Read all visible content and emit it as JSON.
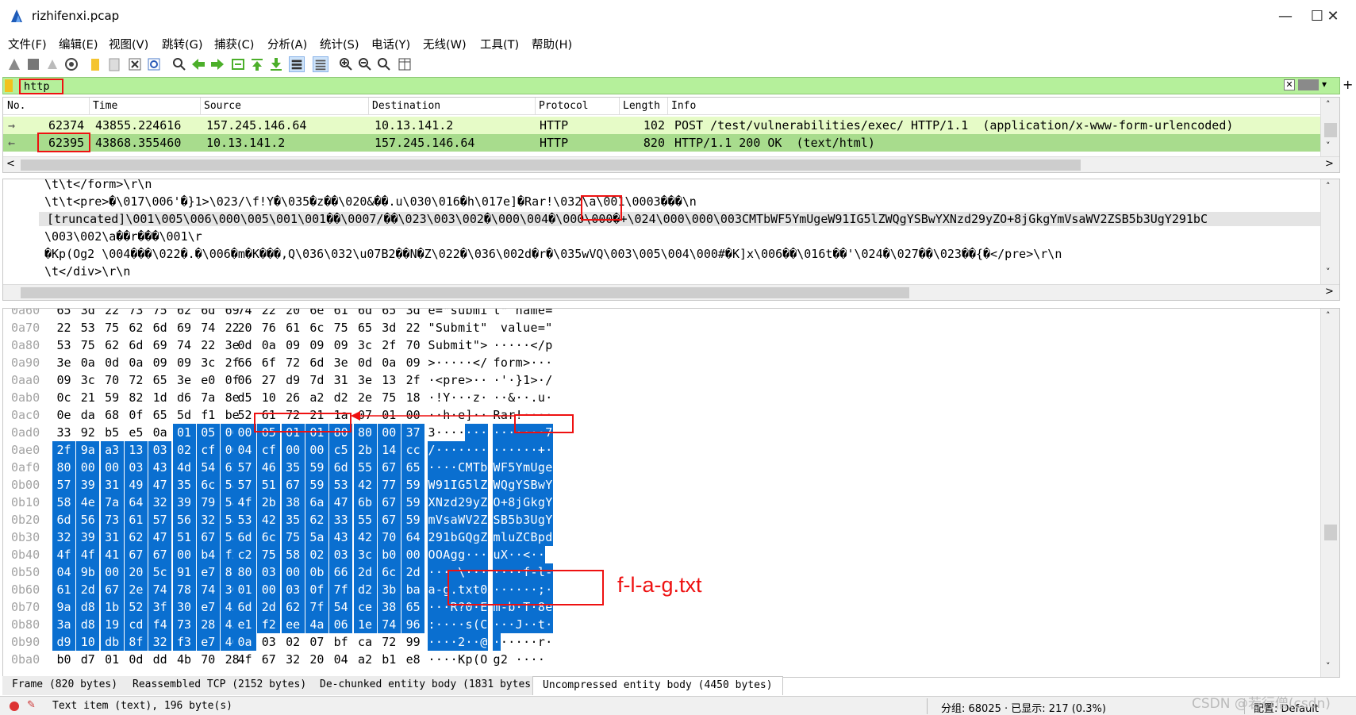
{
  "window": {
    "title": "rizhifenxi.pcap"
  },
  "menu": [
    "文件(F)",
    "编辑(E)",
    "视图(V)",
    "跳转(G)",
    "捕获(C)",
    "分析(A)",
    "统计(S)",
    "电话(Y)",
    "无线(W)",
    "工具(T)",
    "帮助(H)"
  ],
  "filter": {
    "value": "http"
  },
  "packet_list": {
    "columns": [
      "No.",
      "Time",
      "Source",
      "Destination",
      "Protocol",
      "Length",
      "Info"
    ],
    "rows": [
      {
        "no": "62374",
        "time": "43855.224616",
        "source": "157.245.146.64",
        "destination": "10.13.141.2",
        "protocol": "HTTP",
        "length": "102",
        "info": "POST /test/vulnerabilities/exec/ HTTP/1.1  (application/x-www-form-urlencoded)"
      },
      {
        "no": "62395",
        "time": "43868.355460",
        "source": "10.13.141.2",
        "destination": "157.245.146.64",
        "protocol": "HTTP",
        "length": "820",
        "info": "HTTP/1.1 200 OK  (text/html)"
      }
    ]
  },
  "text_pane": {
    "lines": [
      "\\t\\t</form>\\r\\n",
      "\\t\\t<pre>�\\017\\006'�}1>\\023/\\f!Y�\\035�z��\\020&��.u\\030\\016�h\\017e]�Rar!\\032\\a\\001\\0003���\\n",
      "[truncated]\\001\\005\\006\\000\\005\\001\\001��\\0007/��\\023\\003\\002�\\000\\004�\\000\\000�+\\024\\000\\000\\003CMTbWF5YmUgeW91IG5lZWQgYSBwYXNzd29yZO+8jGkgYmVsaWV2ZSB5b3UgY291bC",
      "\\003\\002\\a��r���\\001\\r",
      "�Kp(Og2 \\004���\\022�.�\\006�m�K���,Q\\036\\032\\u07B2��N�Z\\022�\\036\\002d�r�\\035wVQ\\003\\005\\004\\000#�K]x\\006��\\016t��'\\024�\\027��\\023��{�</pre>\\r\\n",
      "\\t</div>\\r\\n"
    ]
  },
  "hex_dump": {
    "rows": [
      {
        "offset": "0a60",
        "bytes": [
          "65",
          "3d",
          "22",
          "73",
          "75",
          "62",
          "6d",
          "69",
          "74",
          "22",
          "20",
          "6e",
          "61",
          "6d",
          "65",
          "3d"
        ],
        "ascii": "e=\"submit\" name="
      },
      {
        "offset": "0a70",
        "bytes": [
          "22",
          "53",
          "75",
          "62",
          "6d",
          "69",
          "74",
          "22",
          "20",
          "76",
          "61",
          "6c",
          "75",
          "65",
          "3d",
          "22"
        ],
        "ascii": "\"Submit\" value=\""
      },
      {
        "offset": "0a80",
        "bytes": [
          "53",
          "75",
          "62",
          "6d",
          "69",
          "74",
          "22",
          "3e",
          "0d",
          "0a",
          "09",
          "09",
          "09",
          "3c",
          "2f",
          "70"
        ],
        "ascii": "Submit\">·····</p"
      },
      {
        "offset": "0a90",
        "bytes": [
          "3e",
          "0a",
          "0d",
          "0a",
          "09",
          "09",
          "3c",
          "2f",
          "66",
          "6f",
          "72",
          "6d",
          "3e",
          "0d",
          "0a",
          "09"
        ],
        "ascii": ">·····</form>···"
      },
      {
        "offset": "0aa0",
        "bytes": [
          "09",
          "3c",
          "70",
          "72",
          "65",
          "3e",
          "e0",
          "0f",
          "06",
          "27",
          "d9",
          "7d",
          "31",
          "3e",
          "13",
          "2f"
        ],
        "ascii": "·<pre>···'·}1>·/"
      },
      {
        "offset": "0ab0",
        "bytes": [
          "0c",
          "21",
          "59",
          "82",
          "1d",
          "d6",
          "7a",
          "8e",
          "d5",
          "10",
          "26",
          "a2",
          "d2",
          "2e",
          "75",
          "18"
        ],
        "ascii": "·!Y···z···&··.u·"
      },
      {
        "offset": "0ac0",
        "bytes": [
          "0e",
          "da",
          "68",
          "0f",
          "65",
          "5d",
          "f1",
          "be",
          "52",
          "61",
          "72",
          "21",
          "1a",
          "07",
          "01",
          "00"
        ],
        "ascii": "··h·e]··Rar!····"
      },
      {
        "offset": "0ad0",
        "bytes": [
          "33",
          "92",
          "b5",
          "e5",
          "0a",
          "01",
          "05",
          "06",
          "00",
          "05",
          "01",
          "01",
          "80",
          "80",
          "00",
          "37"
        ],
        "ascii": "3··············7"
      },
      {
        "offset": "0ae0",
        "bytes": [
          "2f",
          "9a",
          "a3",
          "13",
          "03",
          "02",
          "cf",
          "00",
          "04",
          "cf",
          "00",
          "00",
          "c5",
          "2b",
          "14",
          "cc"
        ],
        "ascii": "/·············+·"
      },
      {
        "offset": "0af0",
        "bytes": [
          "80",
          "00",
          "00",
          "03",
          "43",
          "4d",
          "54",
          "62",
          "57",
          "46",
          "35",
          "59",
          "6d",
          "55",
          "67",
          "65"
        ],
        "ascii": "····CMTbWF5YmUge"
      },
      {
        "offset": "0b00",
        "bytes": [
          "57",
          "39",
          "31",
          "49",
          "47",
          "35",
          "6c",
          "5a",
          "57",
          "51",
          "67",
          "59",
          "53",
          "42",
          "77",
          "59"
        ],
        "ascii": "W91IG5lZWQgYSBwY"
      },
      {
        "offset": "0b10",
        "bytes": [
          "58",
          "4e",
          "7a",
          "64",
          "32",
          "39",
          "79",
          "5a",
          "4f",
          "2b",
          "38",
          "6a",
          "47",
          "6b",
          "67",
          "59"
        ],
        "ascii": "XNzd29yZO+8jGkgY"
      },
      {
        "offset": "0b20",
        "bytes": [
          "6d",
          "56",
          "73",
          "61",
          "57",
          "56",
          "32",
          "5a",
          "53",
          "42",
          "35",
          "62",
          "33",
          "55",
          "67",
          "59"
        ],
        "ascii": "mVsaWV2ZSB5b3UgY"
      },
      {
        "offset": "0b30",
        "bytes": [
          "32",
          "39",
          "31",
          "62",
          "47",
          "51",
          "67",
          "5a",
          "6d",
          "6c",
          "75",
          "5a",
          "43",
          "42",
          "70",
          "64"
        ],
        "ascii": "291bGQgZmluZCBpd"
      },
      {
        "offset": "0b40",
        "bytes": [
          "4f",
          "4f",
          "41",
          "67",
          "67",
          "00",
          "b4",
          "f2",
          "c2",
          "75",
          "58",
          "02",
          "03",
          "3c",
          "b0",
          "00"
        ],
        "ascii": "OOAgg···uX··<··"
      },
      {
        "offset": "0b50",
        "bytes": [
          "04",
          "9b",
          "00",
          "20",
          "5c",
          "91",
          "e7",
          "8b",
          "80",
          "03",
          "00",
          "0b",
          "66",
          "2d",
          "6c",
          "2d"
        ],
        "ascii": "··· \\·······f-l-"
      },
      {
        "offset": "0b60",
        "bytes": [
          "61",
          "2d",
          "67",
          "2e",
          "74",
          "78",
          "74",
          "30",
          "01",
          "00",
          "03",
          "0f",
          "7f",
          "d2",
          "3b",
          "ba"
        ],
        "ascii": "a-g.txt0······;·"
      },
      {
        "offset": "0b70",
        "bytes": [
          "9a",
          "d8",
          "1b",
          "52",
          "3f",
          "30",
          "e7",
          "45",
          "6d",
          "2d",
          "62",
          "7f",
          "54",
          "ce",
          "38",
          "65"
        ],
        "ascii": "···R?0·Em-b·T·8e"
      },
      {
        "offset": "0b80",
        "bytes": [
          "3a",
          "d8",
          "19",
          "cd",
          "f4",
          "73",
          "28",
          "43",
          "e1",
          "f2",
          "ee",
          "4a",
          "06",
          "1e",
          "74",
          "96"
        ],
        "ascii": ":····s(C···J··t·"
      },
      {
        "offset": "0b90",
        "bytes": [
          "d9",
          "10",
          "db",
          "8f",
          "32",
          "f3",
          "e7",
          "40",
          "0a",
          "03",
          "02",
          "07",
          "bf",
          "ca",
          "72",
          "99"
        ],
        "ascii": "····2··@······r·"
      },
      {
        "offset": "0ba0",
        "bytes": [
          "b0",
          "d7",
          "01",
          "0d",
          "dd",
          "4b",
          "70",
          "28",
          "4f",
          "67",
          "32",
          "20",
          "04",
          "a2",
          "b1",
          "e8"
        ],
        "ascii": "····Kp(Og2 ····"
      }
    ]
  },
  "annotation": {
    "flag_label": "f-l-a-g.txt"
  },
  "tabs": [
    "Frame (820 bytes)",
    "Reassembled TCP (2152 bytes)",
    "De-chunked entity body (1831 bytes)",
    "Uncompressed entity body (4450 bytes)"
  ],
  "status": {
    "item": "Text item (text), 196 byte(s)",
    "packets": "分组: 68025 · 已显示: 217 (0.3%)",
    "profile": "配置: Default",
    "watermark": "CSDN @若行僧(csdn)"
  },
  "colors": {
    "filter_ok": "#b5f09b",
    "row_green": "#e6fbc7",
    "row_selected": "#a8dc8d",
    "byte_selection": "#0a6fd0",
    "annotation": "#ee1111"
  }
}
